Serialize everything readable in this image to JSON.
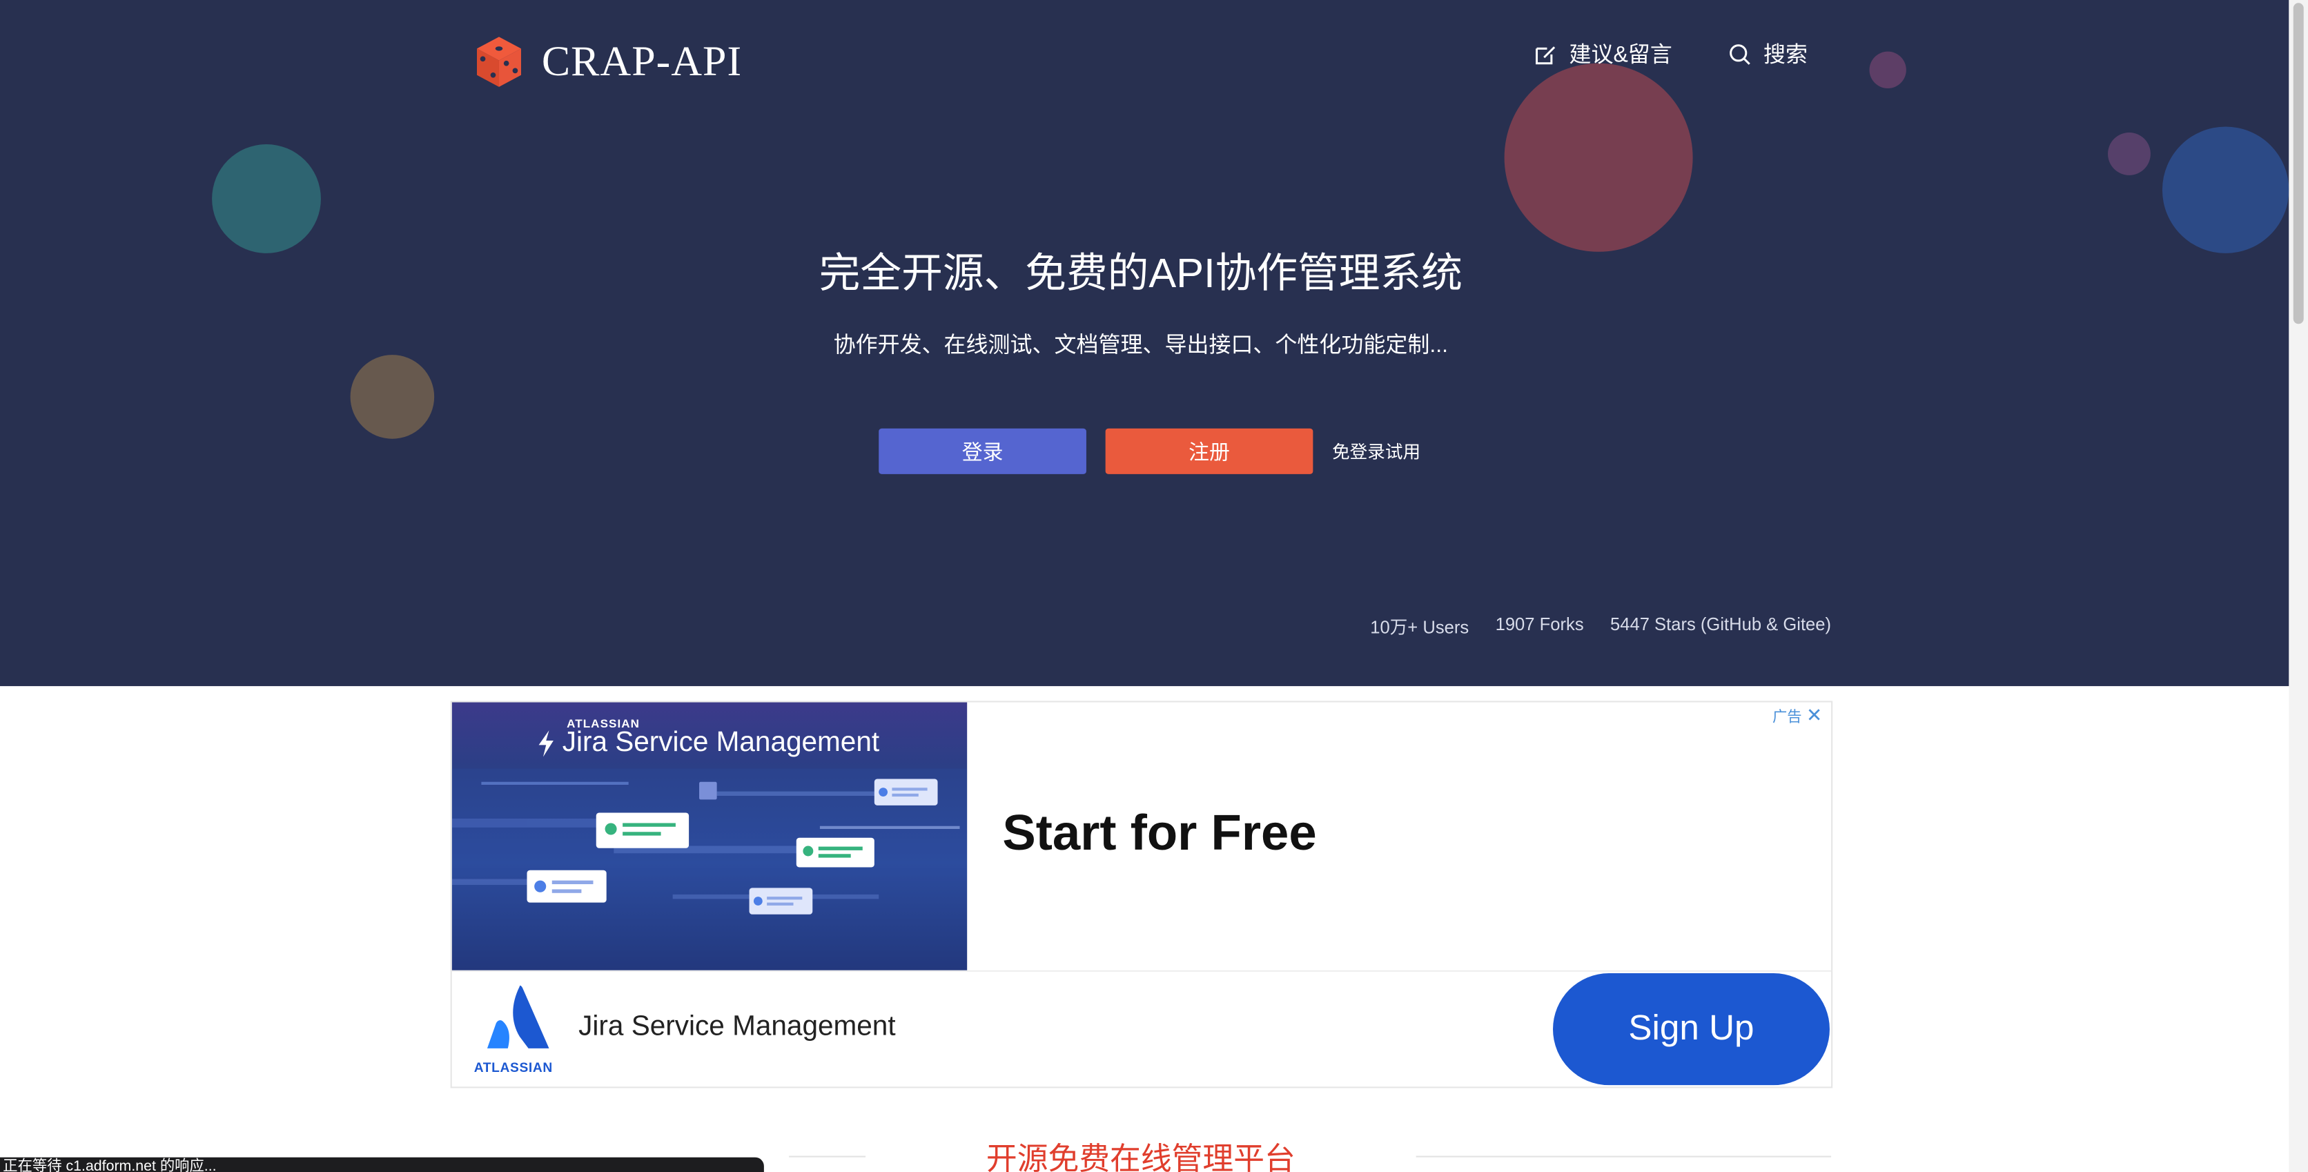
{
  "header": {
    "logo_text": "CRAP-API",
    "nav": [
      {
        "label": "建议&留言",
        "icon": "edit-icon"
      },
      {
        "label": "搜索",
        "icon": "search-icon"
      }
    ]
  },
  "hero": {
    "title": "完全开源、免费的API协作管理系统",
    "subtitle": "协作开发、在线测试、文档管理、导出接口、个性化功能定制...",
    "login_label": "登录",
    "register_label": "注册",
    "trial_label": "免登录试用",
    "stats": [
      "10万+ Users",
      "1907 Forks",
      "5447 Stars (GitHub & Gitee)"
    ]
  },
  "ad": {
    "ad_label": "广告",
    "banner_brand_small": "ATLASSIAN",
    "banner_brand": "Jira Service Management",
    "headline": "Start for Free",
    "bottom_logo_text": "ATLASSIAN",
    "bottom_name": "Jira Service Management",
    "cta_label": "Sign Up"
  },
  "section": {
    "title": "开源免费在线管理平台"
  },
  "status_bar": {
    "text": "正在等待 c1.adform.net 的响应..."
  },
  "colors": {
    "hero_bg": "#283050",
    "login_button": "#5565d0",
    "register_button": "#ea5a3d",
    "section_title": "#e03e2d",
    "ad_cta": "#1c58d1"
  }
}
